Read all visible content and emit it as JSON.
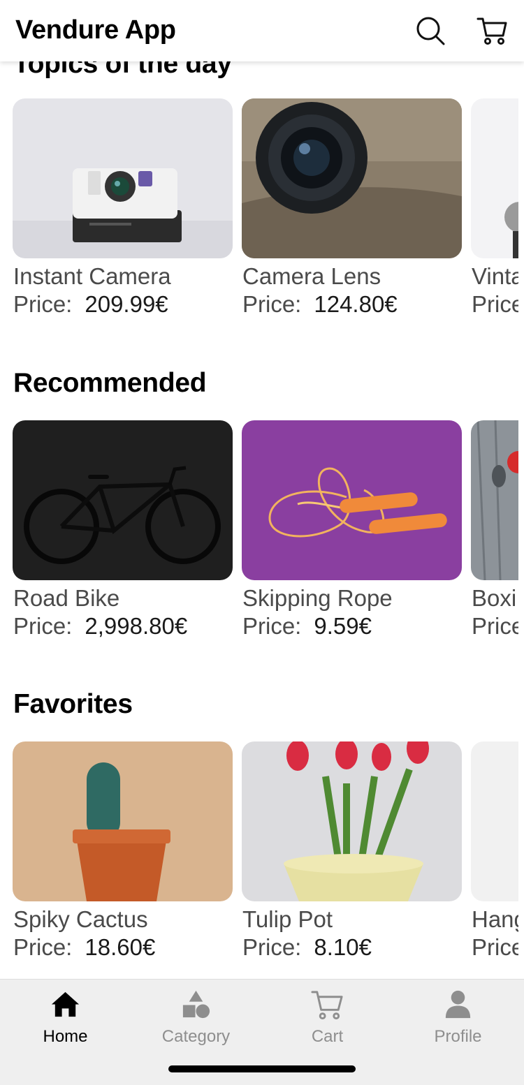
{
  "app": {
    "title": "Vendure App"
  },
  "header_icons": {
    "search": "search-icon",
    "cart": "cart-icon"
  },
  "sections": [
    {
      "title": "Topics of the day",
      "products": [
        {
          "name": "Instant Camera",
          "price_label": "Price:",
          "price": "209.99€"
        },
        {
          "name": "Camera Lens",
          "price_label": "Price:",
          "price": "124.80€"
        },
        {
          "name": "Vinta",
          "price_label": "Price",
          "price": ""
        }
      ]
    },
    {
      "title": "Recommended",
      "products": [
        {
          "name": "Road Bike",
          "price_label": "Price:",
          "price": "2,998.80€"
        },
        {
          "name": "Skipping Rope",
          "price_label": "Price:",
          "price": "9.59€"
        },
        {
          "name": "Boxi",
          "price_label": "Price",
          "price": ""
        }
      ]
    },
    {
      "title": "Favorites",
      "products": [
        {
          "name": "Spiky Cactus",
          "price_label": "Price:",
          "price": "18.60€"
        },
        {
          "name": "Tulip Pot",
          "price_label": "Price:",
          "price": "8.10€"
        },
        {
          "name": "Hang",
          "price_label": "Price",
          "price": ""
        }
      ]
    }
  ],
  "tabbar": {
    "tabs": [
      {
        "label": "Home",
        "icon": "home-icon",
        "active": true
      },
      {
        "label": "Category",
        "icon": "category-icon",
        "active": false
      },
      {
        "label": "Cart",
        "icon": "cart-icon",
        "active": false
      },
      {
        "label": "Profile",
        "icon": "profile-icon",
        "active": false
      }
    ]
  },
  "colors": {
    "active_tab": "#000000",
    "inactive_tab": "#8e8e8e",
    "tabbar_bg": "#efefef"
  }
}
